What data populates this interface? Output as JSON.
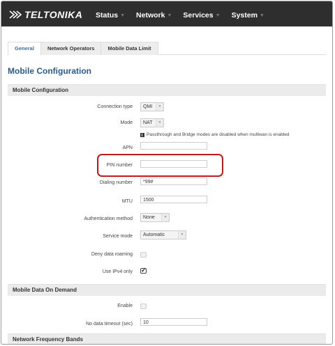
{
  "brand": {
    "logo_text": "TELTONIKA"
  },
  "nav": {
    "status": "Status",
    "network": "Network",
    "services": "Services",
    "system": "System"
  },
  "tabs": {
    "general": "General",
    "network_operators": "Network Operators",
    "mobile_data_limit": "Mobile Data Limit",
    "active": "General"
  },
  "page_title": "Mobile Configuration",
  "section_mobile": {
    "title": "Mobile Configuration",
    "connection_type_label": "Connection type",
    "connection_type_value": "QMI",
    "mode_label": "Mode",
    "mode_value": "NAT",
    "mode_note": "Passthrough and Bridge modes are disabled when multiwan is enabled",
    "apn_label": "APN",
    "apn_value": "",
    "pin_label": "PIN number",
    "pin_value": "",
    "dialing_label": "Dialing number",
    "dialing_value": "*99#",
    "mtu_label": "MTU",
    "mtu_value": "1500",
    "auth_label": "Authentication method",
    "auth_value": "None",
    "service_label": "Service mode",
    "service_value": "Automatic",
    "deny_roaming_label": "Deny data roaming",
    "deny_roaming_checked": false,
    "ipv4_label": "Use IPv4 only",
    "ipv4_checked": true
  },
  "section_on_demand": {
    "title": "Mobile Data On Demand",
    "enable_label": "Enable",
    "enable_checked": false,
    "timeout_label": "No data timeout (sec)",
    "timeout_value": "10"
  },
  "section_bands": {
    "title": "Network Frequency Bands"
  },
  "colors": {
    "highlight": "#c11a1a",
    "topbar": "#2e2e2e",
    "title_blue": "#2c5a89"
  }
}
